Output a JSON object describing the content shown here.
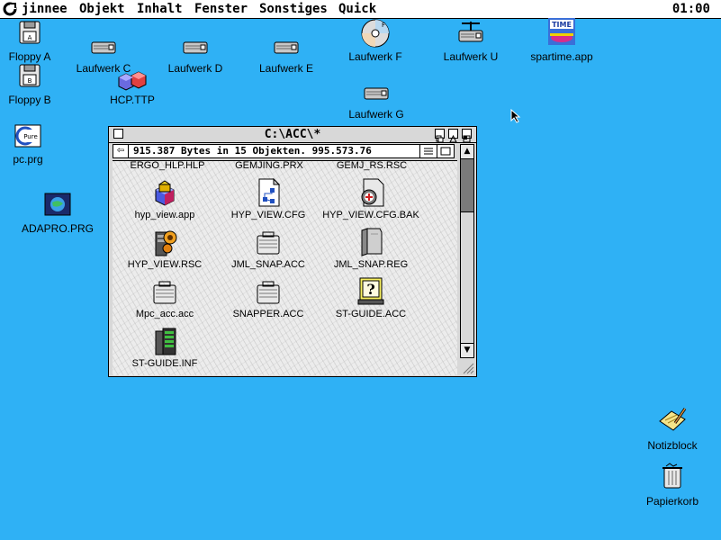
{
  "menubar": {
    "items": [
      "jinnee",
      "Objekt",
      "Inhalt",
      "Fenster",
      "Sonstiges",
      "Quick"
    ],
    "clock": "01:00"
  },
  "desktop": {
    "icons": [
      {
        "label": "Floppy A",
        "icon": "floppy-icon"
      },
      {
        "label": "Floppy B",
        "icon": "floppy-icon"
      },
      {
        "label": "Laufwerk C",
        "icon": "drive-icon"
      },
      {
        "label": "Laufwerk D",
        "icon": "drive-icon"
      },
      {
        "label": "Laufwerk E",
        "icon": "drive-icon"
      },
      {
        "label": "Laufwerk F",
        "icon": "cdrom-icon"
      },
      {
        "label": "Laufwerk U",
        "icon": "network-drive-icon"
      },
      {
        "label": "spartime.app",
        "icon": "spartime-icon"
      },
      {
        "label": "HCP.TTP",
        "icon": "cubes-icon"
      },
      {
        "label": "Laufwerk G",
        "icon": "drive-icon"
      },
      {
        "label": "pc.prg",
        "icon": "pure-c-icon"
      },
      {
        "label": "ADAPRO.PRG",
        "icon": "globe-monitor-icon"
      },
      {
        "label": "Notizblock",
        "icon": "notepad-icon"
      },
      {
        "label": "Papierkorb",
        "icon": "trash-icon"
      }
    ]
  },
  "window": {
    "title": "C:\\ACC\\*",
    "info": "915.387 Bytes in 15 Objekten. 995.573.76",
    "partial_row": [
      "ERGO_HLP.HLP",
      "GEMJING.PRX",
      "GEMJ_RS.RSC"
    ],
    "files": [
      {
        "name": "hyp_view.app",
        "icon": "hyp-view-icon"
      },
      {
        "name": "HYP_VIEW.CFG",
        "icon": "cfg-file-icon"
      },
      {
        "name": "HYP_VIEW.CFG.BAK",
        "icon": "bak-file-icon"
      },
      {
        "name": "HYP_VIEW.RSC",
        "icon": "rsc-file-icon"
      },
      {
        "name": "JML_SNAP.ACC",
        "icon": "acc-file-icon"
      },
      {
        "name": "JML_SNAP.REG",
        "icon": "reg-file-icon"
      },
      {
        "name": "Mpc_acc.acc",
        "icon": "acc-file-icon"
      },
      {
        "name": "SNAPPER.ACC",
        "icon": "acc-file-icon"
      },
      {
        "name": "ST-GUIDE.ACC",
        "icon": "st-guide-icon"
      },
      {
        "name": "ST-GUIDE.INF",
        "icon": "inf-file-icon"
      }
    ]
  },
  "colors": {
    "desktop": "#2fb1f5",
    "window": "#d8d8d8"
  }
}
